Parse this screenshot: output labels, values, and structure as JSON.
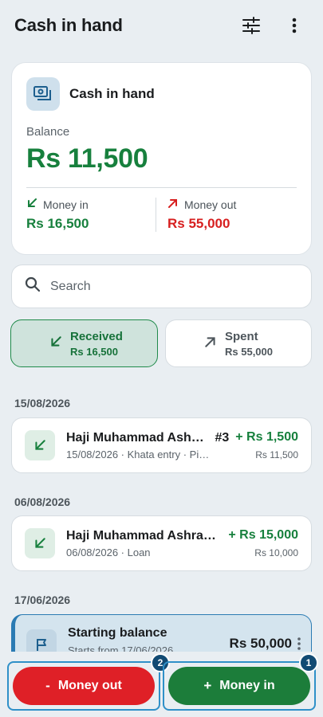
{
  "header": {
    "title": "Cash in hand",
    "filter_icon": "sliders-icon",
    "menu_icon": "more-vertical-icon"
  },
  "summary": {
    "title": "Cash in hand",
    "balance_label": "Balance",
    "balance_value": "Rs 11,500",
    "money_in_label": "Money in",
    "money_in_value": "Rs 16,500",
    "money_out_label": "Money out",
    "money_out_value": "Rs 55,000"
  },
  "search": {
    "placeholder": "Search"
  },
  "segments": {
    "received": {
      "label": "Received",
      "amount": "Rs 16,500"
    },
    "spent": {
      "label": "Spent",
      "amount": "Rs 55,000"
    }
  },
  "groups": [
    {
      "date": "15/08/2026",
      "entry": {
        "name": "Haji Muhammad Ash…",
        "ref": "#3",
        "meta": "15/08/2026 · Khata entry · Pic…",
        "amount": "+ Rs 1,500",
        "balance": "Rs 11,500"
      }
    },
    {
      "date": "06/08/2026",
      "entry": {
        "name": "Haji Muhammad Ashra…",
        "ref": "",
        "meta": "06/08/2026 · Loan",
        "amount": "+ Rs 15,000",
        "balance": "Rs 10,000"
      }
    },
    {
      "date": "17/06/2026",
      "entry": {
        "name": "Starting balance",
        "meta": "Starts from 17/06/2026",
        "amount": "Rs 50,000"
      }
    }
  ],
  "actions": {
    "money_out": {
      "symbol": "-",
      "label": "Money out",
      "badge": "2"
    },
    "money_in": {
      "symbol": "+",
      "label": "Money in",
      "badge": "1"
    }
  },
  "colors": {
    "green": "#17803d",
    "red": "#d71f1f",
    "accent_blue": "#2b7bb3",
    "background": "#e9eef2"
  }
}
